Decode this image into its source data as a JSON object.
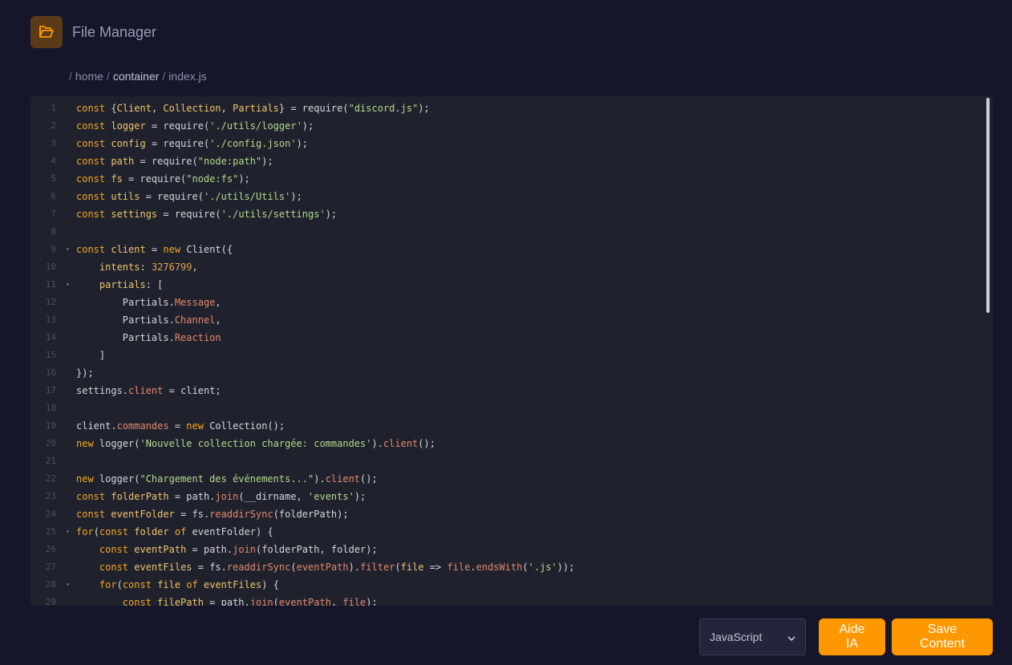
{
  "app": {
    "title": "File Manager",
    "icon": "folder-open-icon",
    "accent": "#ff9800"
  },
  "breadcrumb": {
    "separator": "/",
    "segments": [
      "home",
      "container"
    ],
    "file": "index.js"
  },
  "editor": {
    "lines": [
      [
        [
          "kw",
          "const "
        ],
        [
          "plain",
          "{"
        ],
        [
          "var",
          "Client"
        ],
        [
          "plain",
          ", "
        ],
        [
          "var",
          "Collection"
        ],
        [
          "plain",
          ", "
        ],
        [
          "var",
          "Partials"
        ],
        [
          "plain",
          "} = require("
        ],
        [
          "str",
          "\"discord.js\""
        ],
        [
          "plain",
          ");"
        ]
      ],
      [
        [
          "kw",
          "const "
        ],
        [
          "var",
          "logger"
        ],
        [
          "plain",
          " = require("
        ],
        [
          "str",
          "'./utils/logger'"
        ],
        [
          "plain",
          ");"
        ]
      ],
      [
        [
          "kw",
          "const "
        ],
        [
          "var",
          "config"
        ],
        [
          "plain",
          " = require("
        ],
        [
          "str",
          "'./config.json'"
        ],
        [
          "plain",
          ");"
        ]
      ],
      [
        [
          "kw",
          "const "
        ],
        [
          "var",
          "path"
        ],
        [
          "plain",
          " = require("
        ],
        [
          "str",
          "\"node:path\""
        ],
        [
          "plain",
          ");"
        ]
      ],
      [
        [
          "kw",
          "const "
        ],
        [
          "var",
          "fs"
        ],
        [
          "plain",
          " = require("
        ],
        [
          "str",
          "\"node:fs\""
        ],
        [
          "plain",
          ");"
        ]
      ],
      [
        [
          "kw",
          "const "
        ],
        [
          "var",
          "utils"
        ],
        [
          "plain",
          " = require("
        ],
        [
          "str",
          "'./utils/Utils'"
        ],
        [
          "plain",
          ");"
        ]
      ],
      [
        [
          "kw",
          "const "
        ],
        [
          "var",
          "settings"
        ],
        [
          "plain",
          " = require("
        ],
        [
          "str",
          "'./utils/settings'"
        ],
        [
          "plain",
          ");"
        ]
      ],
      [],
      [
        [
          "kw",
          "const "
        ],
        [
          "var",
          "client"
        ],
        [
          "plain",
          " = "
        ],
        [
          "kw",
          "new "
        ],
        [
          "plain",
          "Client({"
        ]
      ],
      [
        [
          "plain",
          "    "
        ],
        [
          "var",
          "intents"
        ],
        [
          "plain",
          ": "
        ],
        [
          "num",
          "3276799"
        ],
        [
          "plain",
          ","
        ]
      ],
      [
        [
          "plain",
          "    "
        ],
        [
          "var",
          "partials"
        ],
        [
          "plain",
          ": ["
        ]
      ],
      [
        [
          "plain",
          "        Partials."
        ],
        [
          "prop",
          "Message"
        ],
        [
          "plain",
          ","
        ]
      ],
      [
        [
          "plain",
          "        Partials."
        ],
        [
          "prop",
          "Channel"
        ],
        [
          "plain",
          ","
        ]
      ],
      [
        [
          "plain",
          "        Partials."
        ],
        [
          "prop",
          "Reaction"
        ]
      ],
      [
        [
          "plain",
          "    ]"
        ]
      ],
      [
        [
          "plain",
          "});"
        ]
      ],
      [
        [
          "plain",
          "settings."
        ],
        [
          "prop",
          "client"
        ],
        [
          "plain",
          " = client;"
        ]
      ],
      [],
      [
        [
          "plain",
          "client."
        ],
        [
          "prop",
          "commandes"
        ],
        [
          "plain",
          " = "
        ],
        [
          "kw",
          "new "
        ],
        [
          "plain",
          "Collection();"
        ]
      ],
      [
        [
          "kw",
          "new "
        ],
        [
          "plain",
          "logger("
        ],
        [
          "str",
          "'Nouvelle collection chargée: commandes'"
        ],
        [
          "plain",
          ")."
        ],
        [
          "prop",
          "client"
        ],
        [
          "plain",
          "();"
        ]
      ],
      [],
      [
        [
          "kw",
          "new "
        ],
        [
          "plain",
          "logger("
        ],
        [
          "str",
          "\"Chargement des événements...\""
        ],
        [
          "plain",
          ")."
        ],
        [
          "prop",
          "client"
        ],
        [
          "plain",
          "();"
        ]
      ],
      [
        [
          "kw",
          "const "
        ],
        [
          "var",
          "folderPath"
        ],
        [
          "plain",
          " = path."
        ],
        [
          "prop",
          "join"
        ],
        [
          "plain",
          "(__dirname, "
        ],
        [
          "str",
          "'events'"
        ],
        [
          "plain",
          ");"
        ]
      ],
      [
        [
          "kw",
          "const "
        ],
        [
          "var",
          "eventFolder"
        ],
        [
          "plain",
          " = fs."
        ],
        [
          "prop",
          "readdirSync"
        ],
        [
          "plain",
          "(folderPath);"
        ]
      ],
      [
        [
          "kw",
          "for"
        ],
        [
          "plain",
          "("
        ],
        [
          "kw",
          "const "
        ],
        [
          "var",
          "folder "
        ],
        [
          "kw",
          "of "
        ],
        [
          "plain",
          "eventFolder) {"
        ]
      ],
      [
        [
          "plain",
          "    "
        ],
        [
          "kw",
          "const "
        ],
        [
          "var",
          "eventPath"
        ],
        [
          "plain",
          " = path."
        ],
        [
          "prop",
          "join"
        ],
        [
          "plain",
          "(folderPath, folder);"
        ]
      ],
      [
        [
          "plain",
          "    "
        ],
        [
          "kw",
          "const "
        ],
        [
          "var",
          "eventFiles"
        ],
        [
          "plain",
          " = fs."
        ],
        [
          "prop",
          "readdirSync"
        ],
        [
          "plain",
          "("
        ],
        [
          "prop",
          "eventPath"
        ],
        [
          "plain",
          ")."
        ],
        [
          "prop",
          "filter"
        ],
        [
          "plain",
          "("
        ],
        [
          "var",
          "file"
        ],
        [
          "plain",
          " => "
        ],
        [
          "prop",
          "file"
        ],
        [
          "plain",
          "."
        ],
        [
          "prop",
          "endsWith"
        ],
        [
          "plain",
          "("
        ],
        [
          "str",
          "'.js'"
        ],
        [
          "plain",
          "));"
        ]
      ],
      [
        [
          "plain",
          "    "
        ],
        [
          "kw",
          "for"
        ],
        [
          "plain",
          "("
        ],
        [
          "kw",
          "const "
        ],
        [
          "var",
          "file "
        ],
        [
          "kw",
          "of "
        ],
        [
          "var",
          "eventFiles"
        ],
        [
          "plain",
          ") {"
        ]
      ],
      [
        [
          "plain",
          "        "
        ],
        [
          "kw",
          "const "
        ],
        [
          "var",
          "filePath"
        ],
        [
          "plain",
          " = path."
        ],
        [
          "prop",
          "join"
        ],
        [
          "plain",
          "("
        ],
        [
          "prop",
          "eventPath"
        ],
        [
          "plain",
          ", "
        ],
        [
          "prop",
          "file"
        ],
        [
          "plain",
          ");"
        ]
      ]
    ],
    "fold_lines": [
      9,
      11,
      25,
      28
    ],
    "fold_glyph": "▾"
  },
  "footer": {
    "language_select": {
      "selected": "JavaScript",
      "chevron": "chevron-down-icon"
    },
    "aide_button": "Aide IA",
    "save_button": "Save Content"
  }
}
